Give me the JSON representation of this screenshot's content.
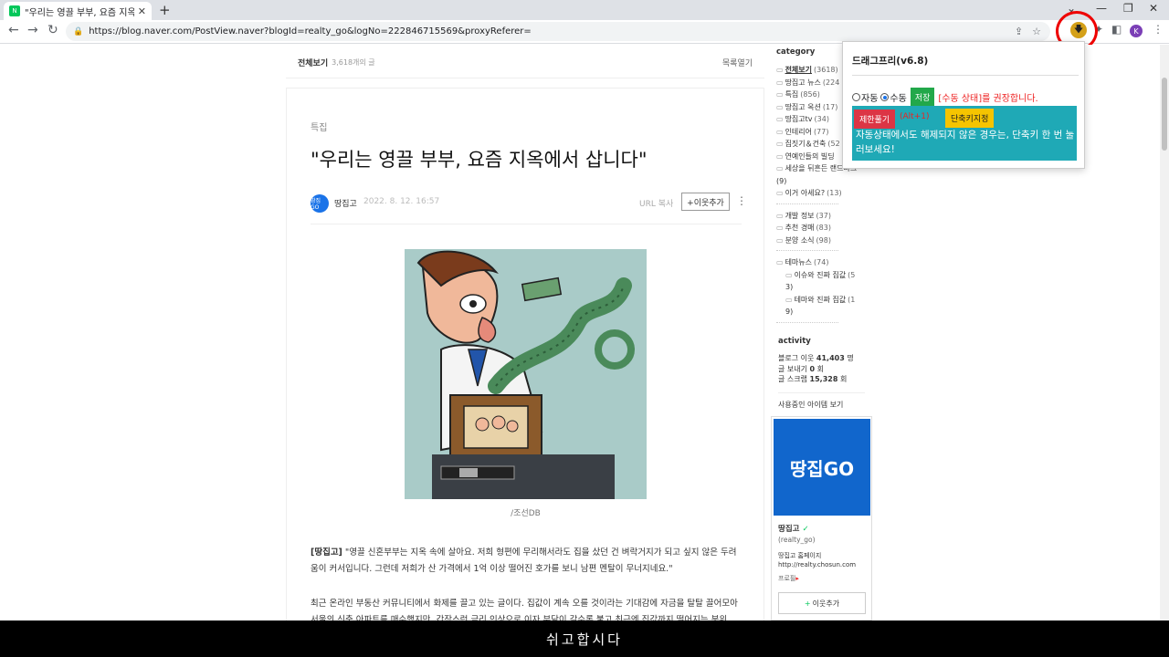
{
  "browser": {
    "tab_title": "\"우리는 영끌 부부, 요즘 지옥에서",
    "tab_favicon": "N",
    "url": "https://blog.naver.com/PostView.naver?blogId=realty_go&logNo=222846715569&proxyReferer=",
    "avatar_letter": "K"
  },
  "listbar": {
    "all_label": "전체보기",
    "count": "3,618개의 글",
    "open_label": "목록열기"
  },
  "post": {
    "category": "특집",
    "title": "\"우리는 영끌 부부, 요즘 지옥에서 삽니다\"",
    "author_badge": "땅집GO",
    "author": "땅집고",
    "date": "2022. 8. 12. 16:57",
    "url_copy": "URL 복사",
    "neighbor_add": "+이웃추가",
    "caption": "/조선DB",
    "para1_lead": "[땅집고]",
    "para1": " \"영끌 신혼부부는 지옥 속에 살아요. 저희 형편에 무리해서라도 집을 샀던 건 벼락거지가 되고 싶지 않은 두려움이 커서입니다. 그런데 저희가 산 가격에서 1억 이상 떨어진 호가를 보니 남편 멘탈이 무너지네요.\"",
    "para2": "최근 온라인 부동산 커뮤니티에서 화제를 끌고 있는 글이다. 집값이 계속 오를 것이라는 기대감에 자금을 탈탈 끌어모아 서울의 신축 아파트를 매수했지만, 갑작스런 금리 인상으로 이자 부담이 갈수록 불고 최근엔 집값까지 떨어지는 분위"
  },
  "sidebar": {
    "category_title": "category",
    "items": [
      {
        "label": "전체보기",
        "count": "(3618)"
      },
      {
        "label": "땅집고 뉴스",
        "count": "(224"
      },
      {
        "label": "특집",
        "count": "(856)"
      },
      {
        "label": "땅집고 옥션",
        "count": "(17)"
      },
      {
        "label": "땅집고tv",
        "count": "(34)"
      },
      {
        "label": "인테리어",
        "count": "(77)"
      },
      {
        "label": "집짓기＆건축",
        "count": "(52"
      },
      {
        "label": "연예인들의 빌딩",
        "count": ""
      },
      {
        "label": "세상을 뒤흔든 랜드마크",
        "count": ""
      },
      {
        "label": "(9)",
        "count": ""
      },
      {
        "label": "이거 아세요?",
        "count": "(13)"
      }
    ],
    "items2": [
      {
        "label": "개발 정보",
        "count": "(37)"
      },
      {
        "label": "추천 경매",
        "count": "(83)"
      },
      {
        "label": "분양 소식",
        "count": "(98)"
      }
    ],
    "items3": [
      {
        "label": "테마뉴스",
        "count": "(74)"
      },
      {
        "label": "이슈와 진짜 집값",
        "count": "(5"
      },
      {
        "label": "3)",
        "count": ""
      },
      {
        "label": "테마와 진짜 집값",
        "count": "(1"
      },
      {
        "label": "9)",
        "count": ""
      }
    ]
  },
  "activity": {
    "title": "activity",
    "neighbors_label": "블로그 이웃",
    "neighbors": "41,403",
    "neighbors_unit": "명",
    "sends_label": "글 보내기",
    "sends": "0",
    "sends_unit": "회",
    "scraps_label": "글 스크랩",
    "scraps": "15,328",
    "scraps_unit": "회",
    "items_label": "사용중인 아이템 보기"
  },
  "profile": {
    "logo": "땅집GO",
    "name": "땅집고",
    "id": "(realty_go)",
    "home": "땅집고 홈페이지  http://realty.chosun.com",
    "prolog": "프로필",
    "add": "이웃추가"
  },
  "popup": {
    "title": "드래그프리(v6.8)",
    "auto": "자동",
    "manual": "수동",
    "save": "저장",
    "recommend": "[수동 상태]를 권장합니다.",
    "unlock": "제한풀기",
    "alt": "(Alt+1)",
    "shortcut": "단축키지정",
    "message": "자동상태에서도 해제되지 않은 경우는, 단축키 한 번 눌러보세요!"
  },
  "subtitle": "쉬고합시다",
  "colors": {
    "naver_green": "#03c75a",
    "popup_panel": "#1fa9b6",
    "logo_blue": "#1166cc"
  }
}
